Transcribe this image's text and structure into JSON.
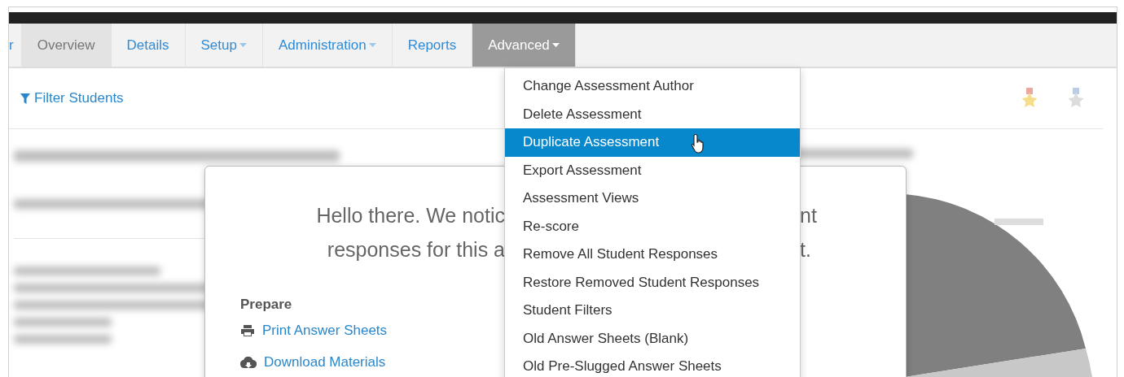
{
  "tabs": [
    {
      "label": "r",
      "selected": false,
      "caret": false,
      "expanded": false
    },
    {
      "label": "Overview",
      "selected": true,
      "caret": false,
      "expanded": false
    },
    {
      "label": "Details",
      "selected": false,
      "caret": false,
      "expanded": false
    },
    {
      "label": "Setup",
      "selected": false,
      "caret": true,
      "expanded": false
    },
    {
      "label": "Administration",
      "selected": false,
      "caret": true,
      "expanded": false
    },
    {
      "label": "Reports",
      "selected": false,
      "caret": false,
      "expanded": false
    },
    {
      "label": "Advanced",
      "selected": false,
      "caret": true,
      "expanded": true
    }
  ],
  "filter_link": "Filter Students",
  "dropdown_menu": [
    {
      "label": "Change Assessment Author",
      "selected": false
    },
    {
      "label": "Delete Assessment",
      "selected": false
    },
    {
      "label": "Duplicate Assessment",
      "selected": true
    },
    {
      "label": "Export Assessment",
      "selected": false
    },
    {
      "label": "Assessment Views",
      "selected": false
    },
    {
      "label": "Re-score",
      "selected": false
    },
    {
      "label": "Remove All Student Responses",
      "selected": false
    },
    {
      "label": "Restore Removed Student Responses",
      "selected": false
    },
    {
      "label": "Student Filters",
      "selected": false
    },
    {
      "label": "Old Answer Sheets (Blank)",
      "selected": false
    },
    {
      "label": "Old Pre-Slugged Answer Sheets",
      "selected": false
    }
  ],
  "modal": {
    "message_lines": [
      {
        "before": "Hello there. We notic",
        "after": "nt"
      },
      {
        "before": "responses for this a",
        "after": "t."
      }
    ],
    "section_heading": "Prepare",
    "links": [
      {
        "kind": "print",
        "label": "Print Answer Sheets"
      },
      {
        "kind": "download",
        "label": "Download Materials"
      }
    ]
  }
}
